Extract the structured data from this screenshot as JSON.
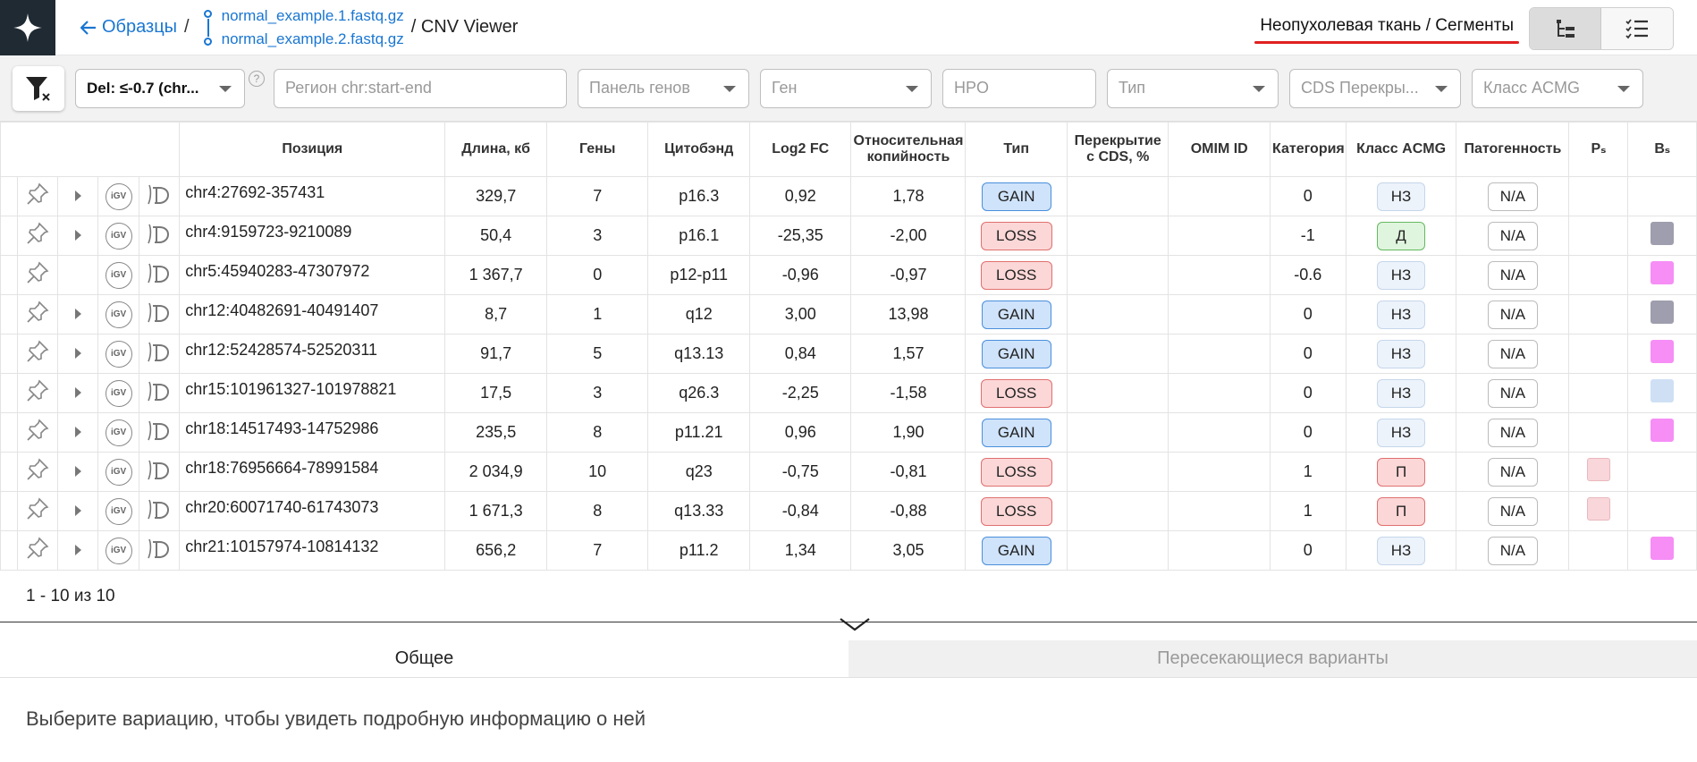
{
  "header": {
    "back_label": "Образцы",
    "separator": "/",
    "files": [
      "normal_example.1.fastq.gz",
      "normal_example.2.fastq.gz"
    ],
    "app_title": "/ CNV Viewer",
    "mode_title": "Неопухолевая ткань / Сегменты"
  },
  "filters": {
    "del_filter": "Del: ≤-0.7 (chr...",
    "region_placeholder": "Регион chr:start-end",
    "gene_panel": "Панель генов",
    "gene": "Ген",
    "hpo": "HPO",
    "type": "Тип",
    "cds_overlap": "CDS Перекры...",
    "acmg_class": "Класс ACMG",
    "help": "?"
  },
  "table": {
    "headers": [
      "Позиция",
      "Длина, кб",
      "Гены",
      "Цитобэнд",
      "Log2 FC",
      "Относительная копийность",
      "Тип",
      "Перекрытие с CDS, %",
      "OMIM ID",
      "Категория",
      "Класс ACMG",
      "Патогенность",
      "Pₛ",
      "Bₛ"
    ],
    "rows": [
      {
        "pos": "chr4:27692-357431",
        "len": "329,7",
        "genes": "7",
        "band": "p16.3",
        "log2": "0,92",
        "rel": "1,78",
        "type": "GAIN",
        "cds": "",
        "omim": "",
        "cat": "0",
        "acmg": "НЗ",
        "path": "N/A",
        "ps": "",
        "bs": "",
        "expand": true
      },
      {
        "pos": "chr4:9159723-9210089",
        "len": "50,4",
        "genes": "3",
        "band": "p16.1",
        "log2": "-25,35",
        "rel": "-2,00",
        "type": "LOSS",
        "cds": "",
        "omim": "",
        "cat": "-1",
        "acmg": "Д",
        "path": "N/A",
        "ps": "",
        "bs": "#9e9eae",
        "expand": true
      },
      {
        "pos": "chr5:45940283-47307972",
        "len": "1 367,7",
        "genes": "0",
        "band": "p12-p11",
        "log2": "-0,96",
        "rel": "-0,97",
        "type": "LOSS",
        "cds": "",
        "omim": "",
        "cat": "-0.6",
        "acmg": "НЗ",
        "path": "N/A",
        "ps": "",
        "bs": "#f68ef6",
        "expand": false
      },
      {
        "pos": "chr12:40482691-40491407",
        "len": "8,7",
        "genes": "1",
        "band": "q12",
        "log2": "3,00",
        "rel": "13,98",
        "type": "GAIN",
        "cds": "",
        "omim": "",
        "cat": "0",
        "acmg": "НЗ",
        "path": "N/A",
        "ps": "",
        "bs": "#9e9eae",
        "expand": true
      },
      {
        "pos": "chr12:52428574-52520311",
        "len": "91,7",
        "genes": "5",
        "band": "q13.13",
        "log2": "0,84",
        "rel": "1,57",
        "type": "GAIN",
        "cds": "",
        "omim": "",
        "cat": "0",
        "acmg": "НЗ",
        "path": "N/A",
        "ps": "",
        "bs": "#f68ef6",
        "expand": true
      },
      {
        "pos": "chr15:101961327-101978821",
        "len": "17,5",
        "genes": "3",
        "band": "q26.3",
        "log2": "-2,25",
        "rel": "-1,58",
        "type": "LOSS",
        "cds": "",
        "omim": "",
        "cat": "0",
        "acmg": "НЗ",
        "path": "N/A",
        "ps": "",
        "bs": "#cfe0f5",
        "expand": true
      },
      {
        "pos": "chr18:14517493-14752986",
        "len": "235,5",
        "genes": "8",
        "band": "p11.21",
        "log2": "0,96",
        "rel": "1,90",
        "type": "GAIN",
        "cds": "",
        "omim": "",
        "cat": "0",
        "acmg": "НЗ",
        "path": "N/A",
        "ps": "",
        "bs": "#f68ef6",
        "expand": true
      },
      {
        "pos": "chr18:76956664-78991584",
        "len": "2 034,9",
        "genes": "10",
        "band": "q23",
        "log2": "-0,75",
        "rel": "-0,81",
        "type": "LOSS",
        "cds": "",
        "omim": "",
        "cat": "1",
        "acmg": "П",
        "path": "N/A",
        "ps": "#f8d6da",
        "bs": "",
        "expand": true
      },
      {
        "pos": "chr20:60071740-61743073",
        "len": "1 671,3",
        "genes": "8",
        "band": "q13.33",
        "log2": "-0,84",
        "rel": "-0,88",
        "type": "LOSS",
        "cds": "",
        "omim": "",
        "cat": "1",
        "acmg": "П",
        "path": "N/A",
        "ps": "#f8d6da",
        "bs": "",
        "expand": true
      },
      {
        "pos": "chr21:10157974-10814132",
        "len": "656,2",
        "genes": "7",
        "band": "p11.2",
        "log2": "1,34",
        "rel": "3,05",
        "type": "GAIN",
        "cds": "",
        "omim": "",
        "cat": "0",
        "acmg": "НЗ",
        "path": "N/A",
        "ps": "",
        "bs": "#f68ef6",
        "expand": true
      }
    ]
  },
  "pagination": "1 - 10 из 10",
  "bottom_tabs": [
    "Общее",
    "Пересекающиеся варианты"
  ],
  "detail_message": "Выберите вариацию, чтобы увидеть подробную информацию о ней",
  "colors": {
    "accent": "#1976d2",
    "underline": "#e02020",
    "logo_bg": "#1f2a33"
  }
}
